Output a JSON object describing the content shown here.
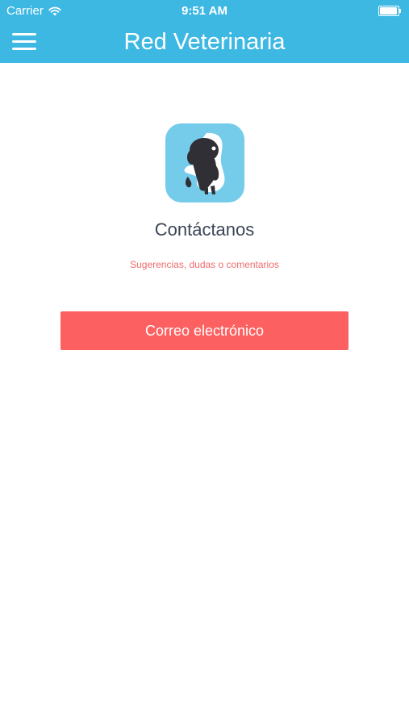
{
  "status_bar": {
    "carrier": "Carrier",
    "time": "9:51 AM"
  },
  "nav": {
    "title": "Red Veterinaria",
    "menu_icon": "hamburger-menu-icon"
  },
  "contact": {
    "title": "Contáctanos",
    "subtitle": "Sugerencias, dudas o comentarios",
    "email_button_label": "Correo electrónico"
  },
  "colors": {
    "header": "#3db8e3",
    "logo_background": "#74cbea",
    "button": "#fd6060",
    "subtitle_text": "#f06b6b",
    "title_text": "#3a4555"
  }
}
